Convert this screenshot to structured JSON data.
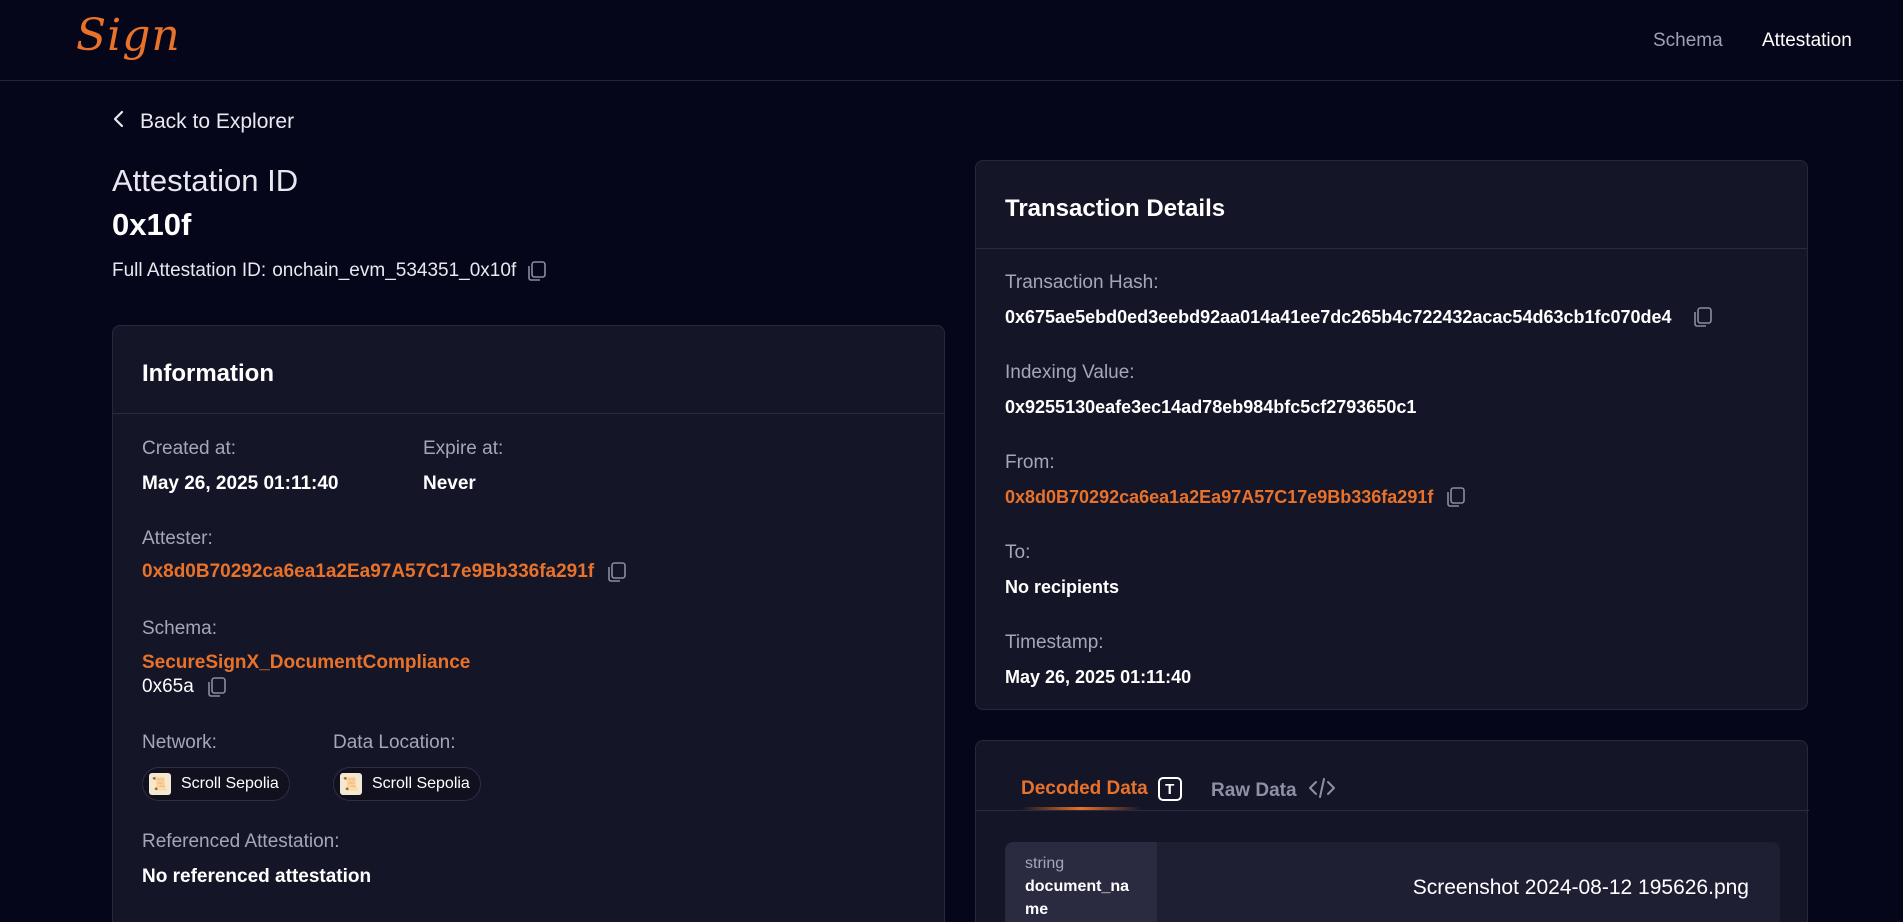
{
  "app": {
    "logo_text": "Sign"
  },
  "nav": {
    "schema": "Schema",
    "attestation": "Attestation"
  },
  "back_label": "Back to Explorer",
  "header": {
    "title": "Attestation ID",
    "id": "0x10f",
    "full_id_label": "Full Attestation ID:",
    "full_id": "onchain_evm_534351_0x10f"
  },
  "information": {
    "title": "Information",
    "created_label": "Created at:",
    "created_value": "May 26, 2025 01:11:40",
    "expire_label": "Expire at:",
    "expire_value": "Never",
    "attester_label": "Attester:",
    "attester_value": "0x8d0B70292ca6ea1a2Ea97A57C17e9Bb336fa291f",
    "schema_label": "Schema:",
    "schema_name": "SecureSignX_DocumentCompliance",
    "schema_id": "0x65a",
    "network_label": "Network:",
    "network_value": "Scroll Sepolia",
    "data_location_label": "Data Location:",
    "data_location_value": "Scroll Sepolia",
    "referenced_label": "Referenced Attestation:",
    "referenced_value": "No referenced attestation"
  },
  "transaction": {
    "title": "Transaction Details",
    "hash_label": "Transaction Hash:",
    "hash_value": "0x675ae5ebd0ed3eebd92aa014a41ee7dc265b4c722432acac54d63cb1fc070de4",
    "indexing_label": "Indexing Value:",
    "indexing_value": "0x9255130eafe3ec14ad78eb984bfc5cf2793650c1",
    "from_label": "From:",
    "from_value": "0x8d0B70292ca6ea1a2Ea97A57C17e9Bb336fa291f",
    "to_label": "To:",
    "to_value": "No recipients",
    "timestamp_label": "Timestamp:",
    "timestamp_value": "May 26, 2025 01:11:40"
  },
  "data_tabs": {
    "decoded": "Decoded Data",
    "decoded_icon_letter": "T",
    "raw": "Raw Data"
  },
  "decoded_rows": [
    {
      "type": "string",
      "name": "document_name",
      "value": "Screenshot 2024-08-12 195626.png"
    }
  ],
  "colors": {
    "accent": "#e8722a",
    "background": "#06061b",
    "card": "#151528"
  },
  "icons": {
    "copy": "copy-icon",
    "back": "chevron-left-icon",
    "network": "scroll-icon",
    "raw": "code-icon"
  }
}
